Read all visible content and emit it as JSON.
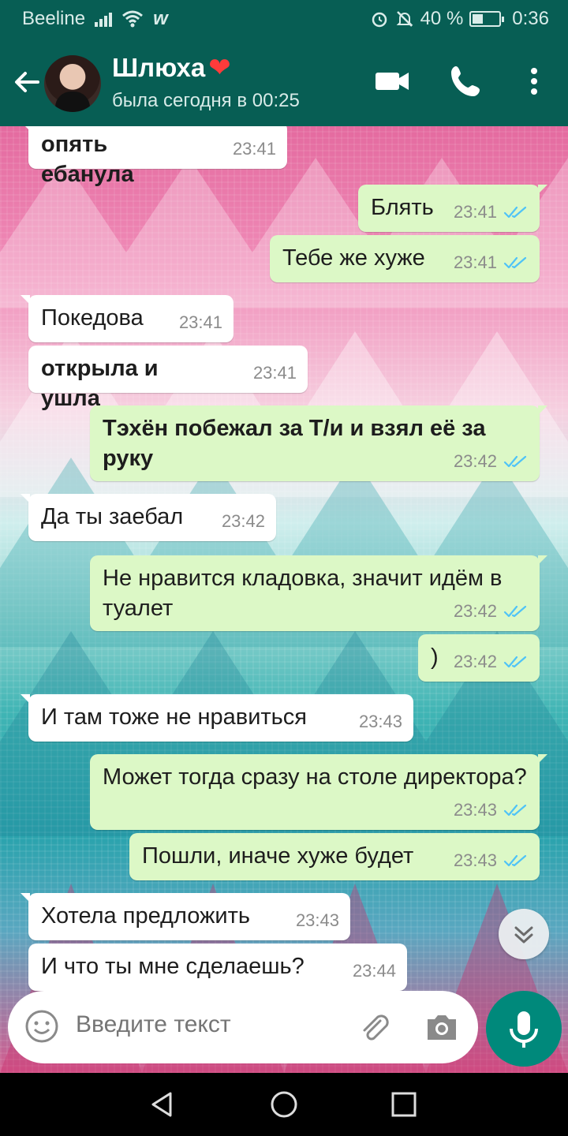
{
  "status_bar": {
    "carrier": "Beeline",
    "battery": "40 %",
    "battery_level": 0.4,
    "time": "0:36"
  },
  "header": {
    "contact_name": "Шлюха",
    "contact_emoji": "❤",
    "last_seen": "была сегодня в 00:25"
  },
  "messages": [
    {
      "dir": "in",
      "text": "опять ебанула",
      "time": "23:41",
      "bold": true
    },
    {
      "dir": "out",
      "text": "Блять",
      "time": "23:41"
    },
    {
      "dir": "out",
      "text": "Тебе же хуже",
      "time": "23:41"
    },
    {
      "dir": "in",
      "text": "Покедова",
      "time": "23:41"
    },
    {
      "dir": "in",
      "text": "открыла и ушла",
      "time": "23:41",
      "bold": true
    },
    {
      "dir": "out",
      "text": "Тэхён побежал за Т/и и взял её за руку",
      "time": "23:42",
      "bold": true
    },
    {
      "dir": "in",
      "text": "Да ты заебал",
      "time": "23:42"
    },
    {
      "dir": "out",
      "text": "Не нравится кладовка, значит идём в туалет",
      "time": "23:42"
    },
    {
      "dir": "out",
      "text": ")",
      "time": "23:42"
    },
    {
      "dir": "in",
      "text": "И там тоже не нравиться",
      "time": "23:43"
    },
    {
      "dir": "out",
      "text": "Может тогда сразу на столе директора?",
      "time": "23:43"
    },
    {
      "dir": "out",
      "text": "Пошли, иначе хуже будет",
      "time": "23:43"
    },
    {
      "dir": "in",
      "text": "Хотела предложить",
      "time": "23:43"
    },
    {
      "dir": "in",
      "text": "И что ты мне сделаешь?",
      "time": "23:44"
    }
  ],
  "composer": {
    "placeholder": "Введите текст"
  },
  "icons": {
    "back": "arrow-left-icon",
    "video": "video-call-icon",
    "call": "phone-icon",
    "menu": "more-vert-icon",
    "emoji": "emoji-icon",
    "attach": "paperclip-icon",
    "camera": "camera-icon",
    "mic": "microphone-icon",
    "scroll": "chevrons-down-icon"
  },
  "colors": {
    "header": "#075e54",
    "incoming": "#ffffff",
    "outgoing": "#dcf8c6",
    "read_ticks": "#4fc3f7",
    "mic": "#00897b"
  }
}
